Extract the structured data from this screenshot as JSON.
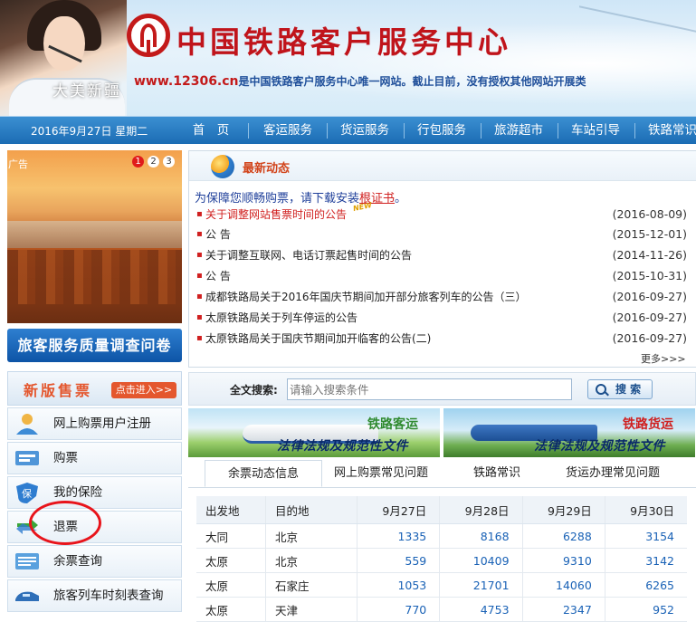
{
  "header": {
    "site_title": "中国铁路客户服务中心",
    "url": "www.12306.cn",
    "url_notice": "是中国铁路客户服务中心唯一网站。截止目前，没有授权其他网站开展类"
  },
  "nav": {
    "date": "2016年9月27日 星期二",
    "items": [
      "首　页",
      "客运服务",
      "货运服务",
      "行包服务",
      "旅游超市",
      "车站引导",
      "铁路常识"
    ]
  },
  "ad": {
    "text": "大美新疆",
    "tag": "广告",
    "pages": [
      "1",
      "2",
      "3"
    ]
  },
  "survey_button": "旅客服务质量调查问卷",
  "new_ticket": {
    "title": "新版售票",
    "enter": "点击进入>>"
  },
  "left_menu": [
    {
      "label": "网上购票用户注册",
      "icon": "user-register-icon"
    },
    {
      "label": "购票",
      "icon": "ticket-icon"
    },
    {
      "label": "我的保险",
      "icon": "insurance-shield-icon"
    },
    {
      "label": "退票",
      "icon": "refund-arrows-icon"
    },
    {
      "label": "余票查询",
      "icon": "remaining-tickets-icon"
    },
    {
      "label": "旅客列车时刻表查询",
      "icon": "train-schedule-icon"
    }
  ],
  "news": {
    "title": "最新动态",
    "notice_prefix": "为保障您顺畅购票，请下载安装",
    "notice_link": "根证书",
    "notice_suffix": "。",
    "new_badge": "NEW",
    "items": [
      {
        "title": "关于调整网站售票时间的公告",
        "date": "(2016-08-09)",
        "highlight": true
      },
      {
        "title": "公 告",
        "date": "(2015-12-01)",
        "highlight": false
      },
      {
        "title": "关于调整互联网、电话订票起售时间的公告",
        "date": "(2014-11-26)",
        "highlight": false
      },
      {
        "title": "公 告",
        "date": "(2015-10-31)",
        "highlight": false
      },
      {
        "title": "成都铁路局关于2016年国庆节期间加开部分旅客列车的公告（三）",
        "date": "(2016-09-27)",
        "highlight": false
      },
      {
        "title": "太原铁路局关于列车停运的公告",
        "date": "(2016-09-27)",
        "highlight": false
      },
      {
        "title": "太原铁路局关于国庆节期间加开临客的公告(二)",
        "date": "(2016-09-27)",
        "highlight": false
      }
    ],
    "more": "更多>>>"
  },
  "search": {
    "label": "全文搜索:",
    "placeholder": "请输入搜索条件",
    "button": "搜 索"
  },
  "banners": [
    {
      "title": "铁路客运",
      "subtitle": "法律法规及规范性文件"
    },
    {
      "title": "铁路货运",
      "subtitle": "法律法规及规范性文件"
    }
  ],
  "tabs": [
    "余票动态信息",
    "网上购票常见问题",
    "铁路常识",
    "货运办理常见问题"
  ],
  "ticket_table": {
    "headers": [
      "出发地",
      "目的地",
      "9月27日",
      "9月28日",
      "9月29日",
      "9月30日"
    ],
    "rows": [
      [
        "大同",
        "北京",
        "1335",
        "8168",
        "6288",
        "3154"
      ],
      [
        "太原",
        "北京",
        "559",
        "10409",
        "9310",
        "3142"
      ],
      [
        "太原",
        "石家庄",
        "1053",
        "21701",
        "14060",
        "6265"
      ],
      [
        "太原",
        "天津",
        "770",
        "4753",
        "2347",
        "952"
      ]
    ]
  },
  "colors": {
    "nav_blue": "#1b6cb4",
    "brand_red": "#c0141b",
    "link_blue": "#1a62b6",
    "annotation_red": "#e8141b"
  }
}
